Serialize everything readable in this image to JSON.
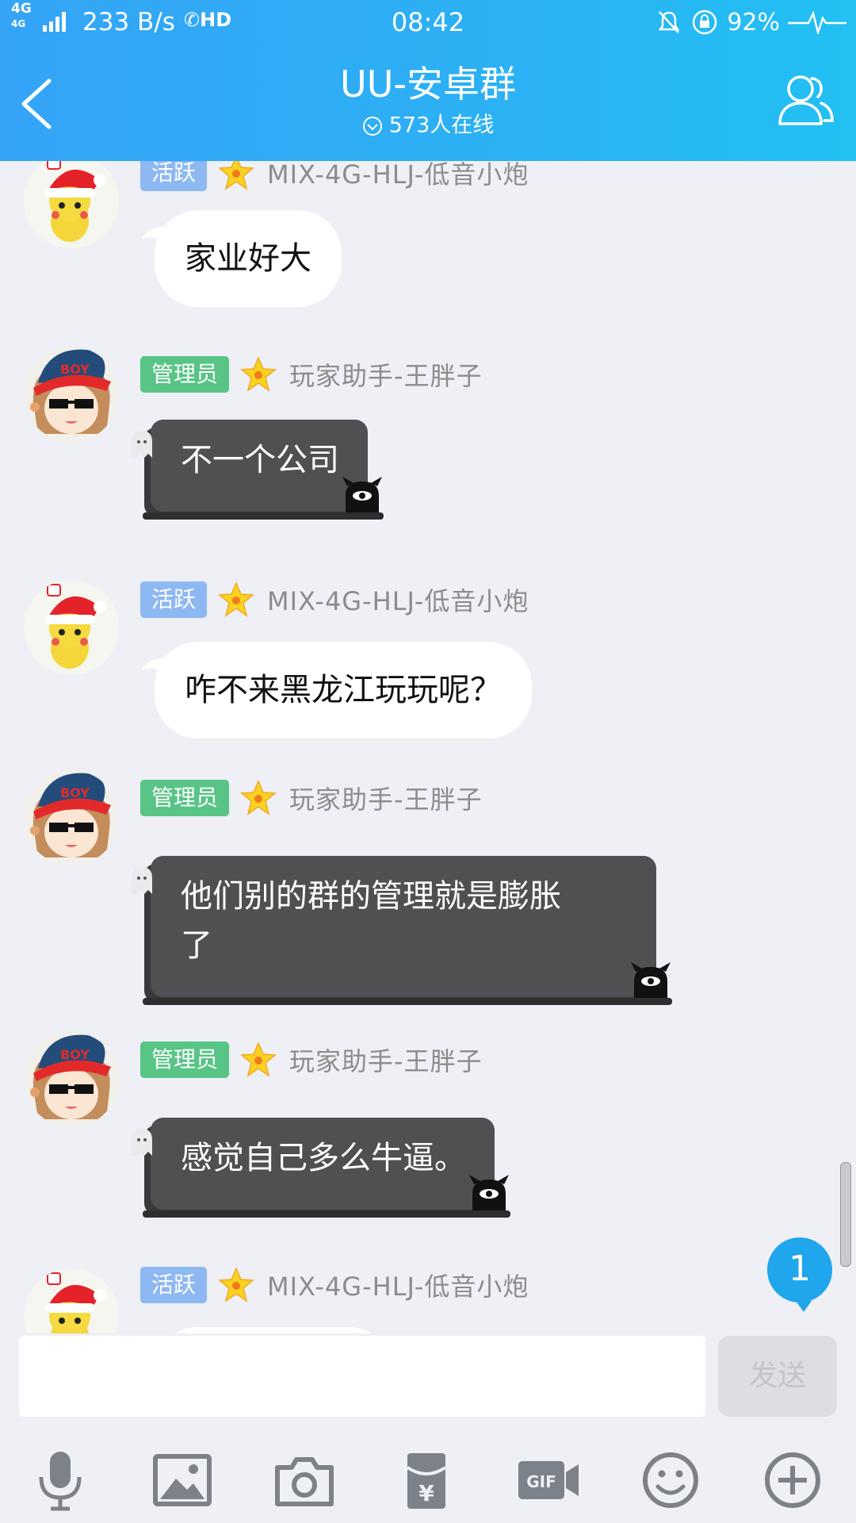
{
  "status_bar": {
    "network": "4G",
    "network_secondary": "4G",
    "speed": "233 B/s",
    "hd": "HD",
    "time": "08:42",
    "battery": "92%"
  },
  "header": {
    "title": "UU-安卓群",
    "online_text": "573人在线"
  },
  "messages": [
    {
      "badge": "活跃",
      "nickname": "MIX-4G-HLJ-低音小炮",
      "text": "家业好大"
    },
    {
      "badge": "管理员",
      "nickname": "玩家助手-王胖子",
      "text": "不一个公司"
    },
    {
      "badge": "活跃",
      "nickname": "MIX-4G-HLJ-低音小炮",
      "text": "咋不来黑龙江玩玩呢？"
    },
    {
      "badge": "管理员",
      "nickname": "玩家助手-王胖子",
      "text_line1": "他们别的群的管理就是膨胀",
      "text_line2": "了"
    },
    {
      "badge": "管理员",
      "nickname": "玩家助手-王胖子",
      "text": "感觉自己多么牛逼。"
    },
    {
      "badge": "活跃",
      "nickname": "MIX-4G-HLJ-低音小炮"
    }
  ],
  "unread_count": "1",
  "input": {
    "value": "",
    "send_label": "发送"
  },
  "toolbar_icons": [
    "microphone-icon",
    "image-icon",
    "camera-icon",
    "red-packet-icon",
    "gif-icon",
    "emoji-icon",
    "plus-icon"
  ],
  "colors": {
    "header": "#2cb0f4",
    "active_badge": "#8eb8f2",
    "admin_badge": "#58c486",
    "dark_bubble": "#4f5052",
    "unread": "#1fa6ec"
  }
}
